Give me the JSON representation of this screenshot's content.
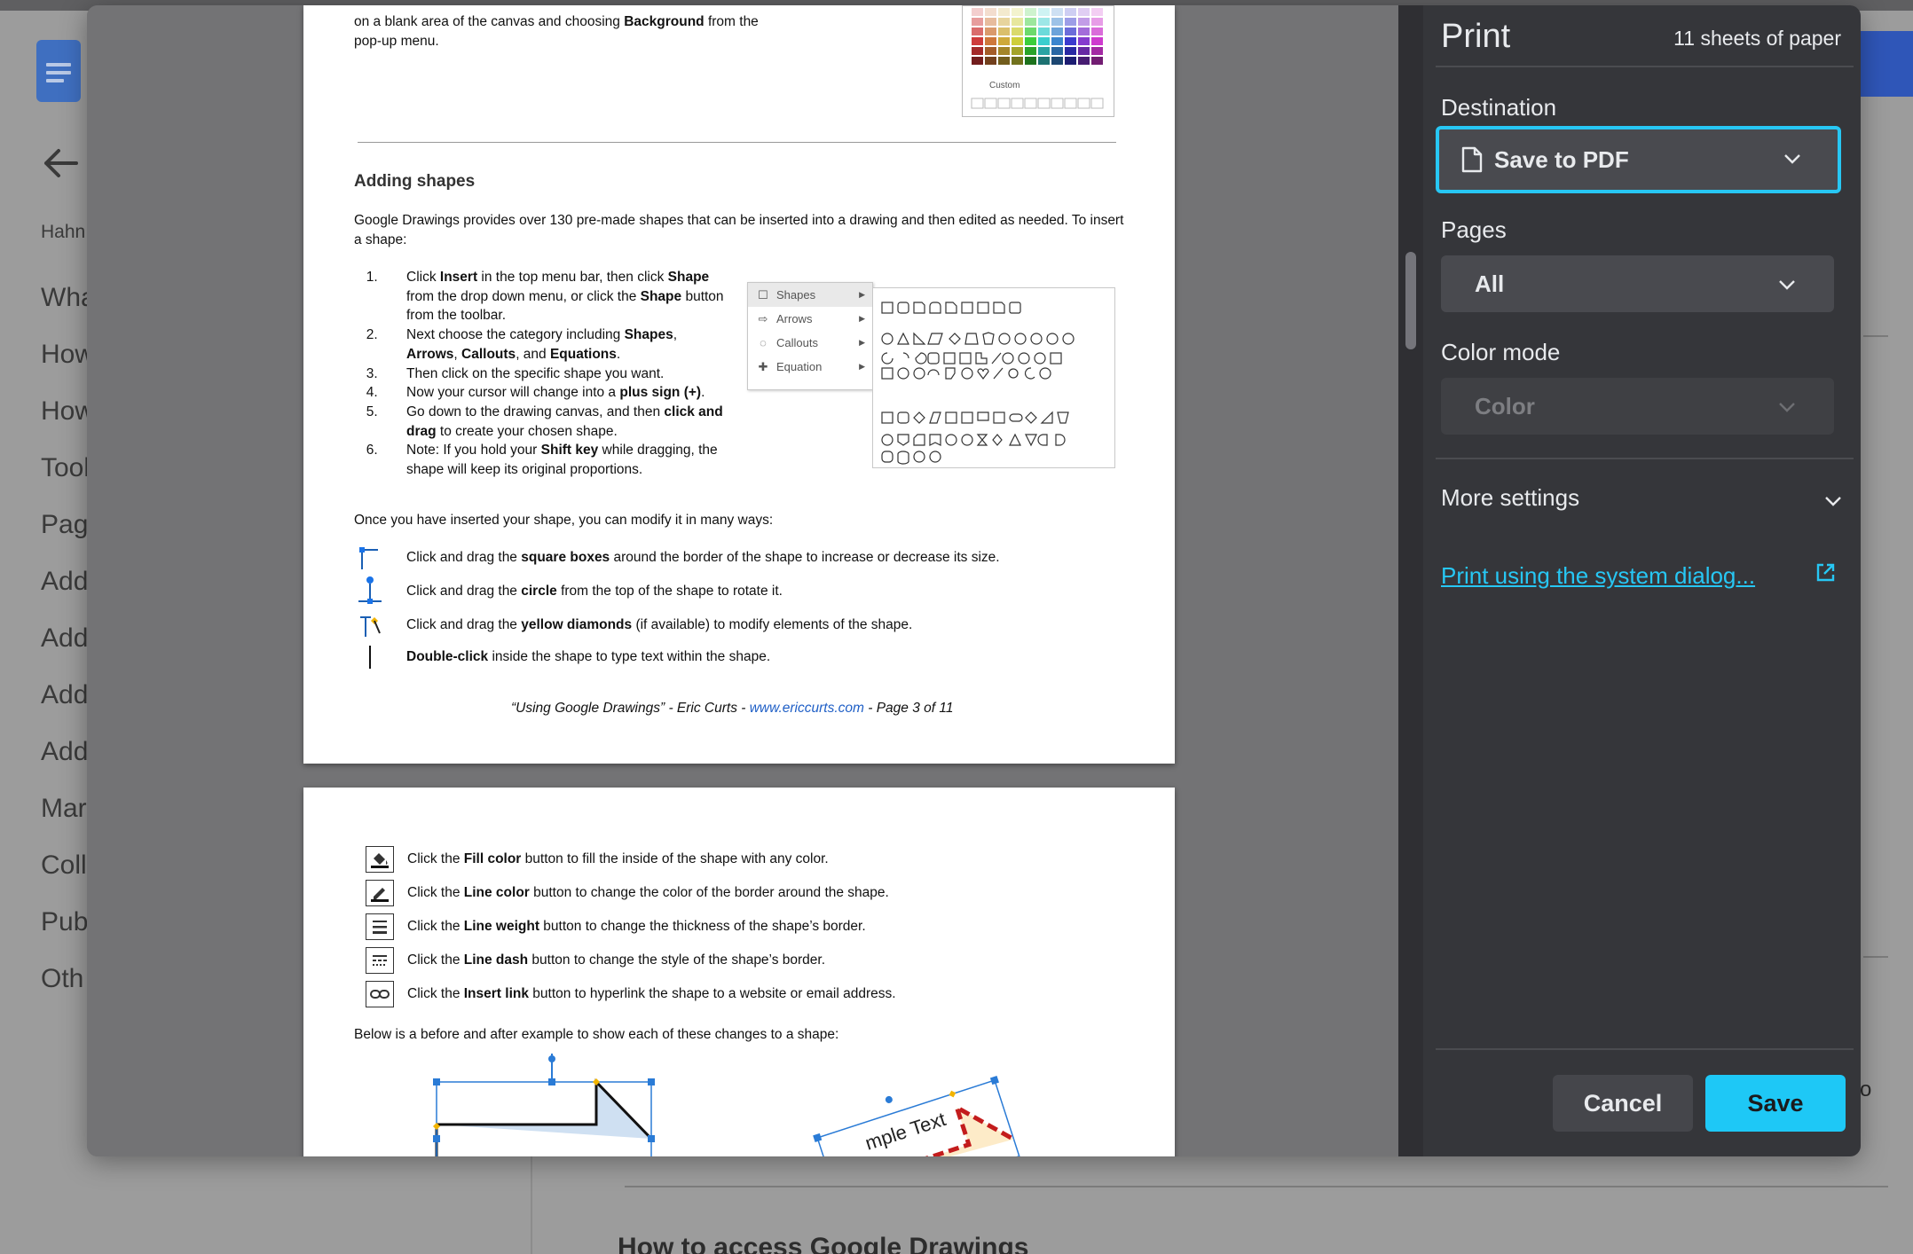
{
  "background": {
    "author_partial": "Hahn",
    "outline_items": [
      "Wha",
      "How",
      "How",
      "Tool",
      "Pag",
      "Add",
      "Add",
      "Add",
      "Add",
      "Mar",
      "Coll",
      "Pub",
      "Oth"
    ],
    "heading_partial": "How to access Google Drawings",
    "right_glyph": "o"
  },
  "dialog": {
    "title": "Print",
    "sheet_count": "11 sheets of paper",
    "destination": {
      "label": "Destination",
      "value": "Save to PDF"
    },
    "pages": {
      "label": "Pages",
      "value": "All"
    },
    "color_mode": {
      "label": "Color mode",
      "value": "Color"
    },
    "more_settings": "More settings",
    "system_dialog_link": "Print using the system dialog...",
    "cancel_label": "Cancel",
    "save_label": "Save",
    "accent_color": "#27c7f4"
  },
  "preview": {
    "page3": {
      "top_text_1": "on a blank area of the canvas and choosing",
      "top_text_bold": "Background",
      "top_text_2": "from the",
      "top_text_3": "pop-up menu.",
      "palette_custom": "Custom",
      "section_title": "Adding shapes",
      "intro": "Google Drawings provides over 130 pre-made shapes that can be inserted into a drawing and then edited as needed. To insert a shape:",
      "steps": [
        {
          "a": "Click ",
          "b": "Insert",
          "c": " in the top menu bar, then click ",
          "d": "Shape",
          "e": " from the drop down menu, or click the ",
          "f": "Shape",
          "g": " button from the toolbar."
        },
        {
          "a": "Next choose the category including ",
          "b": "Shapes",
          "c": ", ",
          "d": "Arrows",
          "e": ", ",
          "f": "Callouts",
          "g": ", and ",
          "h": "Equations",
          "i": "."
        },
        {
          "a": "Then click on the specific shape you want."
        },
        {
          "a": "Now your cursor will change into a ",
          "b": "plus sign (+)",
          "c": "."
        },
        {
          "a": "Go down to the drawing canvas, and then ",
          "b": "click and drag",
          "c": " to create your chosen shape."
        },
        {
          "a": "Note: If you hold your ",
          "b": "Shift key",
          "c": " while dragging, the shape will keep its original proportions."
        }
      ],
      "menu_items": [
        "Shapes",
        "Arrows",
        "Callouts",
        "Equation"
      ],
      "modify_intro": "Once you have inserted your shape, you can modify it in many ways:",
      "bullets": [
        {
          "a": "Click and drag the ",
          "b": "square boxes",
          "c": " around the border of the shape to increase or decrease its size."
        },
        {
          "a": "Click and drag the ",
          "b": "circle",
          "c": " from the top of the shape to rotate it."
        },
        {
          "a": "Click and drag the ",
          "b": "yellow diamonds",
          "c": " (if available) to modify elements of the shape."
        },
        {
          "a": "",
          "b": "Double-click",
          "c": " inside the shape to type text within the shape."
        }
      ],
      "footer_a": "“Using Google Drawings” - Eric Curts - ",
      "footer_link": "www.ericcurts.com",
      "footer_b": " - Page 3 of 11"
    },
    "page4": {
      "tools": [
        {
          "a": "Click the ",
          "b": "Fill color",
          "c": " button to fill the inside of the shape with any color."
        },
        {
          "a": "Click the ",
          "b": "Line color",
          "c": " button to change the color of the border around the shape."
        },
        {
          "a": "Click the ",
          "b": "Line weight",
          "c": " button to change the thickness of the shape’s border."
        },
        {
          "a": "Click the ",
          "b": "Line dash",
          "c": " button to change the style of the shape’s border."
        },
        {
          "a": "Click the ",
          "b": "Insert link",
          "c": " button to hyperlink the shape to a website or email address."
        }
      ],
      "example_intro": "Below is a before and after example to show each of these changes to a shape:",
      "sample_text": "mple Text"
    }
  }
}
